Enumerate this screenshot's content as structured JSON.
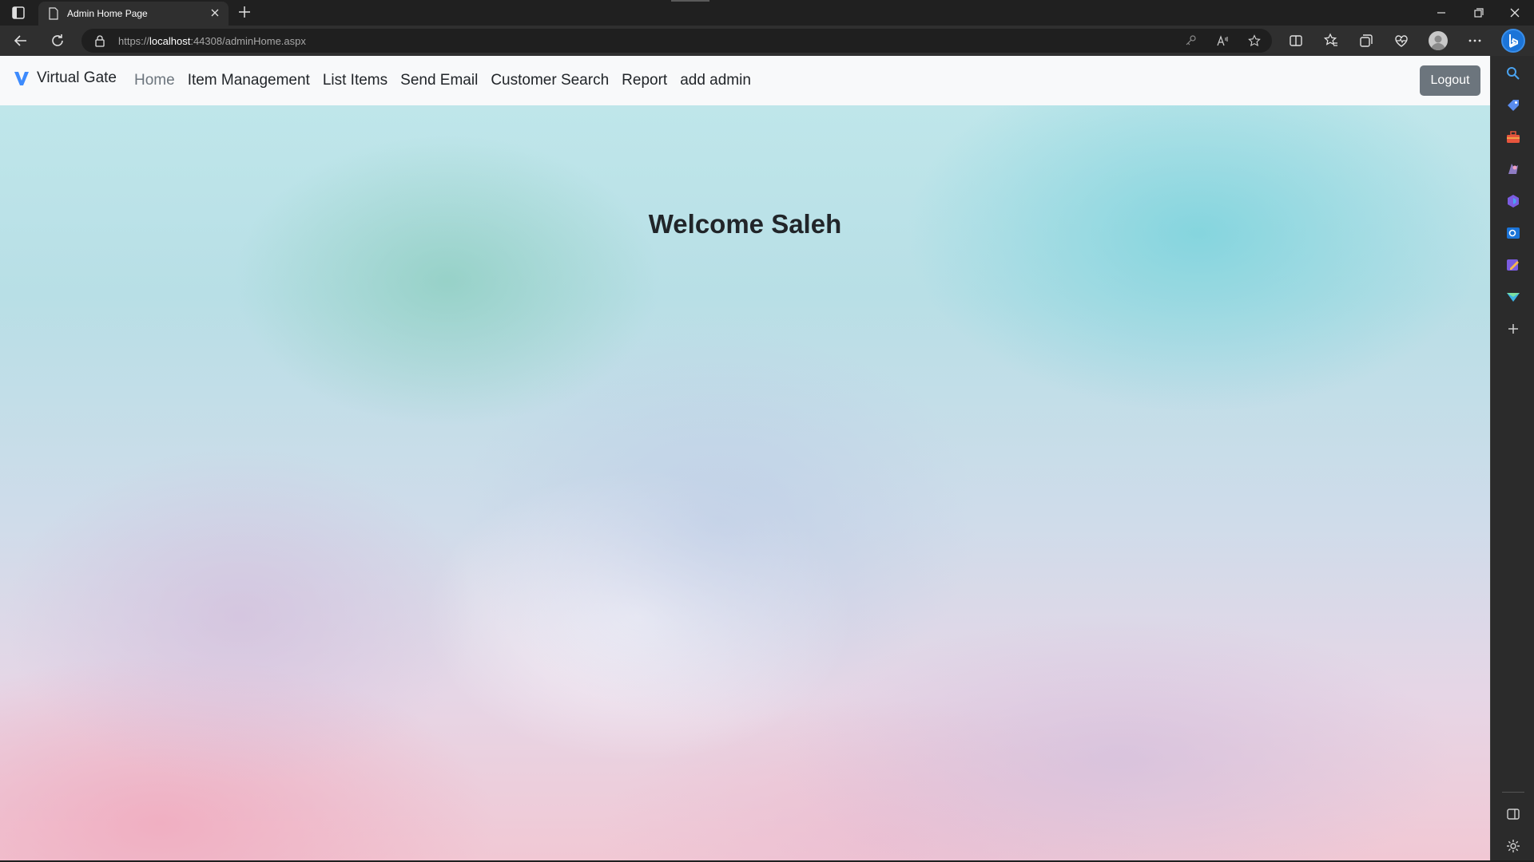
{
  "browser": {
    "tab": {
      "title": "Admin Home Page"
    },
    "address": {
      "scheme": "https://",
      "host": "localhost",
      "rest": ":44308/adminHome.aspx"
    }
  },
  "navbar": {
    "brand": "Virtual Gate",
    "links": [
      "Home",
      "Item Management",
      "List Items",
      "Send Email",
      "Customer Search",
      "Report",
      "add admin"
    ],
    "active_index": 0,
    "logout_label": "Logout"
  },
  "main": {
    "heading": "Welcome Saleh"
  },
  "colors": {
    "brand_blue": "#3d8bfd",
    "logout_bg": "#6c757d",
    "navbar_bg": "#f8f9fa"
  },
  "icons": {
    "sidebar": [
      "search-icon",
      "tag-icon",
      "toolbox-icon",
      "games-icon",
      "m365-icon",
      "outlook-icon",
      "designer-icon",
      "send-icon",
      "add-icon",
      "sidebar-toggle-icon",
      "settings-icon"
    ]
  }
}
